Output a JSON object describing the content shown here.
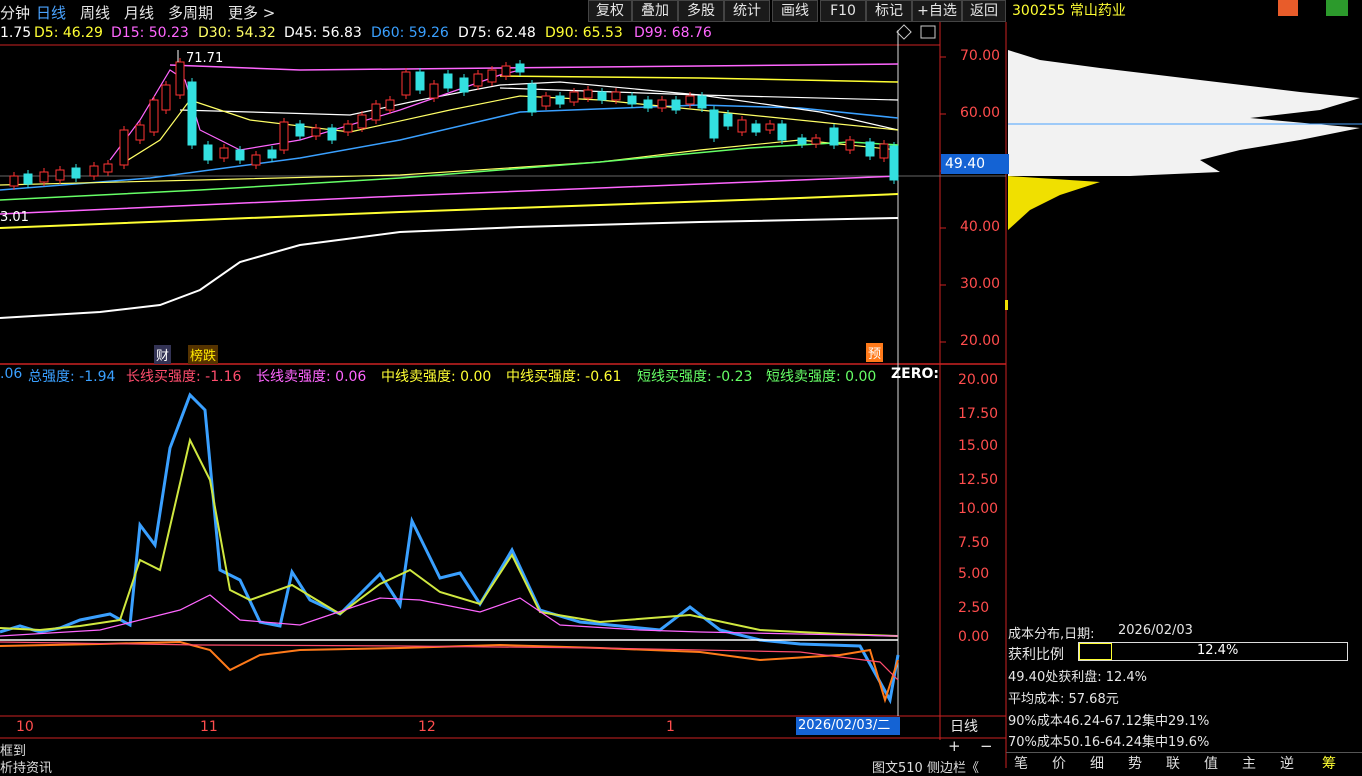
{
  "toolbar": {
    "periods": [
      "分钟",
      "日线",
      "周线",
      "月线",
      "多周期",
      "更多 >"
    ],
    "buttons": [
      "复权",
      "叠加",
      "多股",
      "统计",
      "画线",
      "F10",
      "标记",
      "+自选",
      "返回"
    ],
    "stock_title": "300255 常山药业"
  },
  "ma_legend": [
    {
      "label": "1.75",
      "color": "#ffffff"
    },
    {
      "label": "D5: 46.29",
      "color": "#ffff33"
    },
    {
      "label": "D15: 50.23",
      "color": "#ff66ff"
    },
    {
      "label": "D30: 54.32",
      "color": "#ffff66"
    },
    {
      "label": "D45: 56.83",
      "color": "#ffffff"
    },
    {
      "label": "D60: 59.26",
      "color": "#3aa0ff"
    },
    {
      "label": "D75: 62.48",
      "color": "#ffffff"
    },
    {
      "label": "D90: 65.53",
      "color": "#ffff33"
    },
    {
      "label": "D99: 68.76",
      "color": "#ff66ff"
    }
  ],
  "price_chart": {
    "high_label": "71.71",
    "low_label": "3.01",
    "current_price": "49.40",
    "y_ticks": [
      "70.00",
      "60.00",
      "50.00",
      "40.00",
      "30.00",
      "20.00"
    ],
    "markers": [
      "财",
      "榜跌",
      "预"
    ]
  },
  "indicator_legend": [
    {
      "label": ".06",
      "color": "#3aa0ff"
    },
    {
      "label": "总强度: -1.94",
      "color": "#3aa0ff"
    },
    {
      "label": "长线买强度: -1.16",
      "color": "#ff4d6d"
    },
    {
      "label": "长线卖强度: 0.06",
      "color": "#ff66ff"
    },
    {
      "label": "中线卖强度: 0.00",
      "color": "#ffff33"
    },
    {
      "label": "中线买强度: -0.61",
      "color": "#ffff33"
    },
    {
      "label": "短线买强度: -0.23",
      "color": "#66ff66"
    },
    {
      "label": "短线卖强度: 0.00",
      "color": "#66ff66"
    },
    {
      "label": "ZERO:",
      "color": "#ffffff"
    }
  ],
  "indicator_chart": {
    "y_ticks": [
      "20.00",
      "17.50",
      "15.00",
      "12.50",
      "10.00",
      "7.50",
      "5.00",
      "2.50",
      "0.00"
    ]
  },
  "x_axis": {
    "labels": [
      "10",
      "11",
      "12",
      "1"
    ],
    "cursor_date": "2026/02/03/二",
    "period_label": "日线",
    "zoom_in": "+",
    "zoom_out": "−"
  },
  "cost_panel": {
    "title": "成本分布,日期:",
    "date": "2026/02/03",
    "profit_label": "获利比例",
    "profit_value": "12.4%",
    "profit_ratio": 0.124,
    "line_at_price": "49.40处获利盘: 12.4%",
    "avg_cost": "平均成本: 57.68元",
    "cost90": "90%成本46.24-67.12集中29.1%",
    "cost70": "70%成本50.16-64.24集中19.6%"
  },
  "bottom": {
    "left_text": "框到",
    "left_text2": "析持资讯",
    "status": "图文510 侧边栏《",
    "tabs": [
      "笔",
      "价",
      "细",
      "势",
      "联",
      "值",
      "主",
      "逆",
      "筹"
    ]
  },
  "colors": {
    "up": "#ff3333",
    "down": "#33e0e0",
    "frame": "#cc2222",
    "axis_text": "#ff4d4d"
  }
}
